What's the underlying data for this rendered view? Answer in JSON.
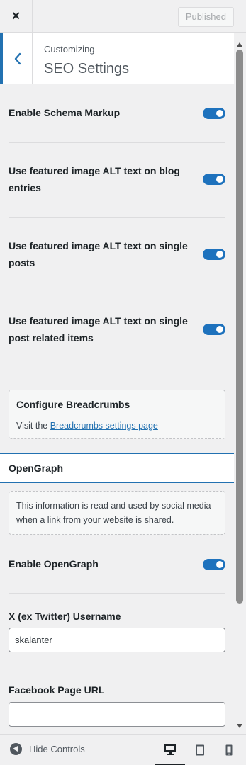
{
  "topbar": {
    "close_label": "×",
    "publish_label": "Published"
  },
  "section": {
    "back_glyph": "‹",
    "crumb": "Customizing",
    "title": "SEO Settings"
  },
  "toggles": [
    {
      "label": "Enable Schema Markup",
      "enabled": true
    },
    {
      "label": "Use featured image ALT text on blog entries",
      "enabled": true
    },
    {
      "label": "Use featured image ALT text on single posts",
      "enabled": true
    },
    {
      "label": "Use featured image ALT text on single post related items",
      "enabled": true
    }
  ],
  "breadcrumbs_box": {
    "title": "Configure Breadcrumbs",
    "text_prefix": "Visit the ",
    "link": "Breadcrumbs settings page"
  },
  "opengraph": {
    "heading": "OpenGraph",
    "info": "This information is read and used by social media when a link from your website is shared.",
    "enable_label": "Enable OpenGraph",
    "enabled": true
  },
  "fields": {
    "twitter_label": "X (ex Twitter) Username",
    "twitter_value": "skalanter",
    "facebook_label": "Facebook Page URL",
    "facebook_value": ""
  },
  "footer": {
    "hide_label": "Hide Controls",
    "devices": [
      "desktop-icon",
      "tablet-icon",
      "mobile-icon"
    ],
    "active_device": "desktop"
  },
  "colors": {
    "accent": "#2271b1",
    "toggle_on": "#1e72bd"
  }
}
